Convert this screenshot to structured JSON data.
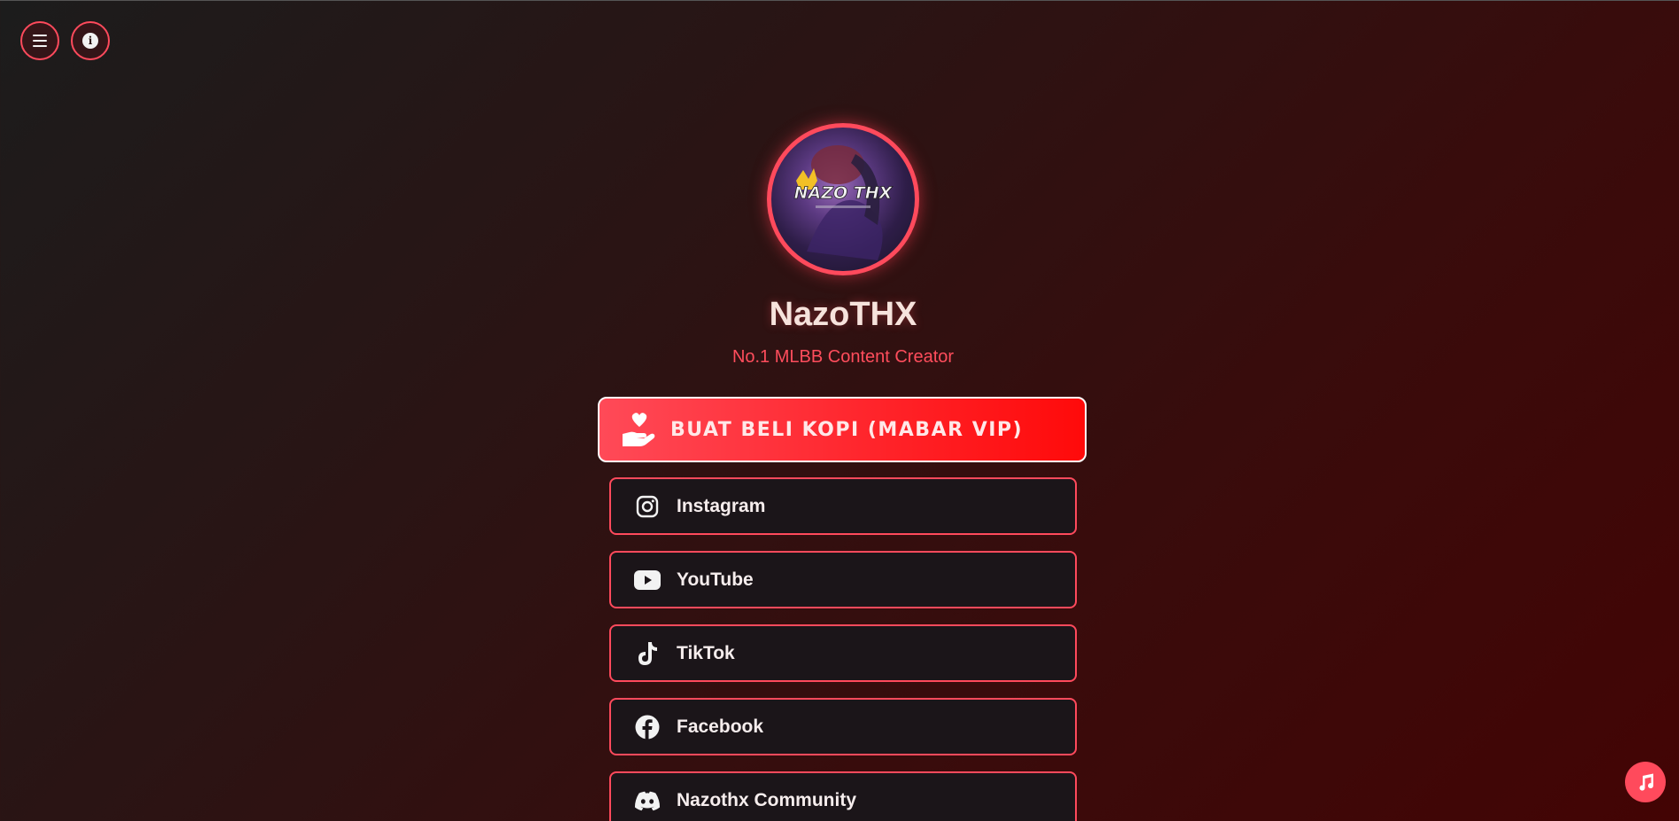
{
  "top_bar": {
    "menu_icon": "hamburger-icon",
    "info_icon": "info-icon"
  },
  "profile": {
    "avatar_text": "NAZO THX",
    "name": "NazoTHX",
    "tagline": "No.1 MLBB Content Creator"
  },
  "vip_button": {
    "label": "BUAT BELI KOPI (MABAR VIP)",
    "icon": "hand-heart-icon"
  },
  "links": [
    {
      "label": "Instagram",
      "icon": "instagram-icon"
    },
    {
      "label": "YouTube",
      "icon": "youtube-icon"
    },
    {
      "label": "TikTok",
      "icon": "tiktok-icon"
    },
    {
      "label": "Facebook",
      "icon": "facebook-icon"
    },
    {
      "label": "Nazothx Community",
      "icon": "discord-icon"
    }
  ],
  "music_button": {
    "icon": "music-note-icon"
  },
  "colors": {
    "accent": "#ff4a5c",
    "vip_red": "#ff1a1a",
    "card_bg": "#1b1519",
    "text": "#f6e3dc"
  }
}
